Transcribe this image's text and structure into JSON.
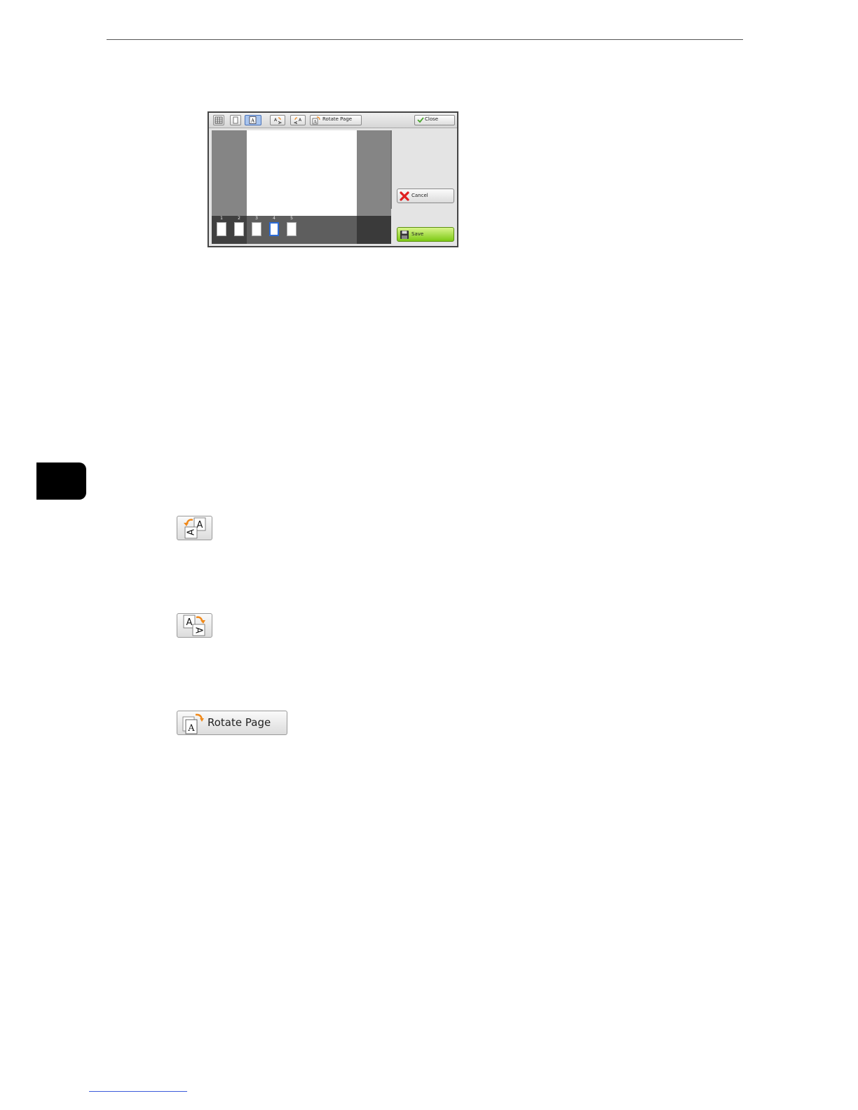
{
  "screen": {
    "toolbar": {
      "rotate_page_label": "Rotate Page",
      "close_label": "Close"
    },
    "thumbnails": [
      "1",
      "2",
      "3",
      "4",
      "5"
    ],
    "selected_thumbnail": "4",
    "cancel_label": "Cancel",
    "save_label": "Save"
  },
  "icons": {
    "rotate_left": "rotate-left-icon",
    "rotate_right": "rotate-right-icon",
    "rotate_page": "rotate-page-icon"
  },
  "rotate_page_button_label": "Rotate Page",
  "colors": {
    "chapter_tab": "#000000",
    "selected_thumb": "#2c6bd6",
    "save_green": "#7cc914",
    "cancel_x": "#e02020",
    "arrow_orange": "#f08a1c"
  }
}
